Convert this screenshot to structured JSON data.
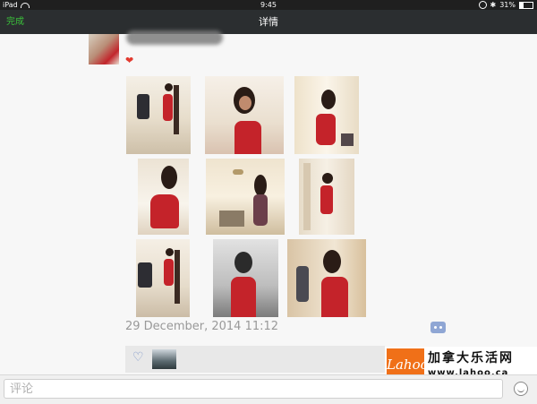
{
  "statusbar": {
    "device": "iPad",
    "time": "9:45",
    "battery": "31%"
  },
  "navbar": {
    "done_label": "完成",
    "title": "详情"
  },
  "post": {
    "timestamp": "29 December, 2014 11:12",
    "photos": [
      "photo-1",
      "photo-2",
      "photo-3",
      "photo-4",
      "photo-5",
      "photo-6",
      "photo-7",
      "photo-8",
      "photo-9"
    ]
  },
  "comment": {
    "placeholder": "评论"
  },
  "watermark": {
    "logo": "Lahoo",
    "name": "加拿大乐活网",
    "url": "www.lahoo.ca"
  },
  "icons": {
    "like": "heart-icon",
    "comment": "comment-icon",
    "emoji": "emoji-icon"
  },
  "colors": {
    "done": "#3bc23b",
    "navbar": "#2b2e30",
    "heart": "#e23a2f",
    "like": "#7a93c8",
    "logo": "#f07018"
  }
}
